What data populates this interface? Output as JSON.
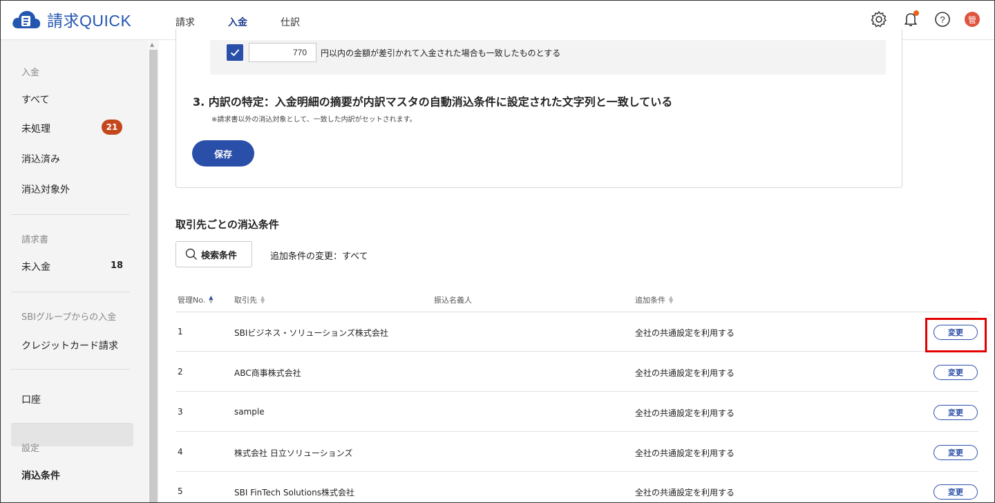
{
  "app": {
    "logo_text_kanji": "請求",
    "logo_text_latin": "QUICK"
  },
  "topnav": {
    "items": [
      "請求",
      "入金",
      "仕訳"
    ],
    "active": "入金"
  },
  "header_icons": [
    "gear-icon",
    "bell-icon",
    "help-icon",
    "avatar"
  ],
  "avatar_text": "管",
  "sidebar": {
    "sections": [
      {
        "title": "入金",
        "items": [
          {
            "label": "すべて"
          },
          {
            "label": "未処理",
            "badge": "21"
          },
          {
            "label": "消込済み"
          },
          {
            "label": "消込対象外"
          }
        ]
      },
      {
        "title": "請求書",
        "items": [
          {
            "label": "未入金",
            "count": "18"
          }
        ]
      },
      {
        "title": "SBIグループからの入金",
        "items": [
          {
            "label": "クレジットカード請求"
          }
        ]
      },
      {
        "title": "",
        "items": [
          {
            "label": "口座"
          }
        ]
      },
      {
        "title": "設定",
        "items": [
          {
            "label": "消込条件",
            "active": true
          }
        ]
      }
    ]
  },
  "condition": {
    "checkbox_checked": true,
    "amount_value": "770",
    "amount_text": "円以内の金額が差引かれて入金された場合も一致したものとする",
    "step3_title": "3.  内訳の特定：入金明細の摘要が内訳マスタの自動消込条件に設定された文字列と一致している",
    "step3_note": "※請求書以外の消込対象として、一致した内訳がセットされます。",
    "save_label": "保存"
  },
  "partner_section": {
    "title": "取引先ごとの消込条件",
    "search_label": "検索条件",
    "filter_text": "追加条件の変更：すべて",
    "columns": [
      "管理No.",
      "取引先",
      "振込名義人",
      "追加条件"
    ],
    "rows": [
      {
        "no": "1",
        "partner": "SBIビジネス・ソリューションズ株式会社",
        "payer": "",
        "condition": "全社の共通設定を利用する",
        "action": "変更"
      },
      {
        "no": "2",
        "partner": "ABC商事株式会社",
        "payer": "",
        "condition": "全社の共通設定を利用する",
        "action": "変更"
      },
      {
        "no": "3",
        "partner": "sample",
        "payer": "",
        "condition": "全社の共通設定を利用する",
        "action": "変更"
      },
      {
        "no": "4",
        "partner": "株式会社  日立ソリューションズ",
        "payer": "",
        "condition": "全社の共通設定を利用する",
        "action": "変更"
      },
      {
        "no": "5",
        "partner": "SBI FinTech Solutions株式会社",
        "payer": "",
        "condition": "全社の共通設定を利用する",
        "action": "変更"
      }
    ]
  },
  "colors": {
    "brand_blue": "#2a4fa8",
    "badge_red": "#c4471c",
    "highlight_red": "#e30000"
  }
}
